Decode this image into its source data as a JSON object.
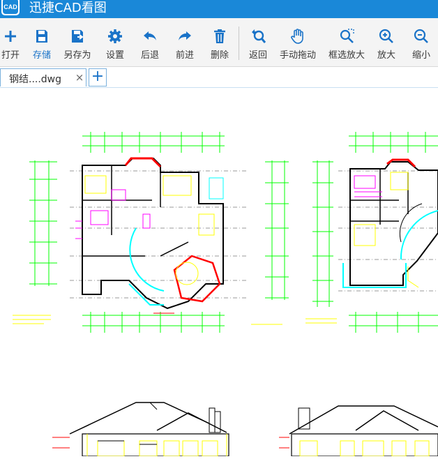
{
  "titlebar": {
    "logo_text": "CAD",
    "title": "迅捷CAD看图",
    "color": "#1a88d8"
  },
  "toolbar": {
    "items": [
      {
        "id": "open",
        "label": "打开",
        "icon": "plus-icon",
        "active": false
      },
      {
        "id": "save",
        "label": "存储",
        "icon": "floppy-disk-icon",
        "active": true
      },
      {
        "id": "save-as",
        "label": "另存为",
        "icon": "save-as-icon",
        "active": false
      },
      {
        "id": "settings",
        "label": "设置",
        "icon": "gear-icon",
        "active": false
      },
      {
        "id": "undo",
        "label": "后退",
        "icon": "undo-arrow-icon",
        "active": false
      },
      {
        "id": "redo",
        "label": "前进",
        "icon": "redo-arrow-icon",
        "active": false
      },
      {
        "id": "delete",
        "label": "删除",
        "icon": "trash-icon",
        "active": false
      },
      {
        "id": "back",
        "label": "返回",
        "icon": "return-zoom-icon",
        "active": false
      },
      {
        "id": "pan",
        "label": "手动拖动",
        "icon": "hand-icon",
        "active": false
      },
      {
        "id": "zoom-window",
        "label": "框选放大",
        "icon": "zoom-window-icon",
        "active": false
      },
      {
        "id": "zoom-in",
        "label": "放大",
        "icon": "zoom-in-icon",
        "active": false
      },
      {
        "id": "zoom-out",
        "label": "缩小",
        "icon": "zoom-out-icon",
        "active": false
      }
    ],
    "accent": "#1a73c8"
  },
  "tabs": {
    "items": [
      {
        "label": "钢结....dwg",
        "close": "×"
      }
    ],
    "add_label": "+"
  },
  "drawing": {
    "background": "#ffffff",
    "line_colors": [
      "#00ff00",
      "#ffff00",
      "#ff0000",
      "#ff00ff",
      "#00ffff",
      "#000000"
    ]
  }
}
